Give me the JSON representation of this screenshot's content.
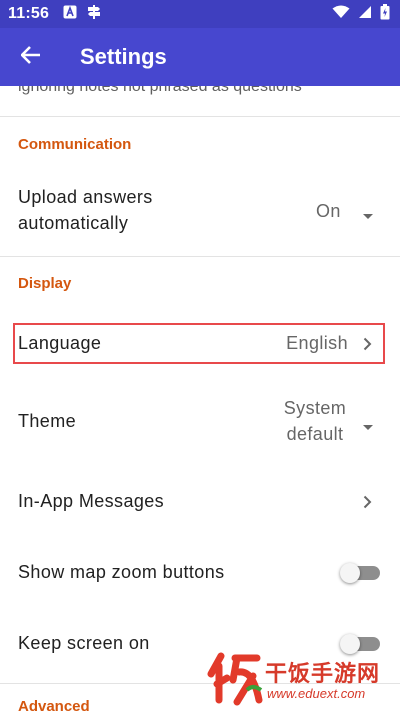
{
  "status_bar": {
    "time": "11:56",
    "left_icons": [
      "app-a-icon",
      "signpost-icon"
    ],
    "right_icons": [
      "wifi-icon",
      "cellular-icon",
      "battery-icon"
    ],
    "background": "#3f3fbf"
  },
  "app_bar": {
    "title": "Settings",
    "back_icon": "arrow-back-icon",
    "background": "#4747cf"
  },
  "clipped_row_text": "ignoring notes not phrased as questions",
  "sections": {
    "communication": {
      "header": "Communication",
      "upload": {
        "title": "Upload answers automatically",
        "value": "On",
        "control": "dropdown"
      }
    },
    "display": {
      "header": "Display",
      "language": {
        "title": "Language",
        "value": "English",
        "control": "chevron"
      },
      "theme": {
        "title": "Theme",
        "value": "System default",
        "control": "dropdown"
      },
      "messages": {
        "title": "In-App Messages",
        "control": "chevron"
      },
      "zoom_buttons": {
        "title": "Show map zoom buttons",
        "checked": false
      },
      "screen_on": {
        "title": "Keep screen on",
        "checked": false
      }
    },
    "advanced": {
      "header": "Advanced"
    }
  },
  "watermark": {
    "text": "干饭手游网",
    "url": "www.eduext.com"
  },
  "colors": {
    "section_header": "#d4570f",
    "highlight": "#e8494b"
  }
}
